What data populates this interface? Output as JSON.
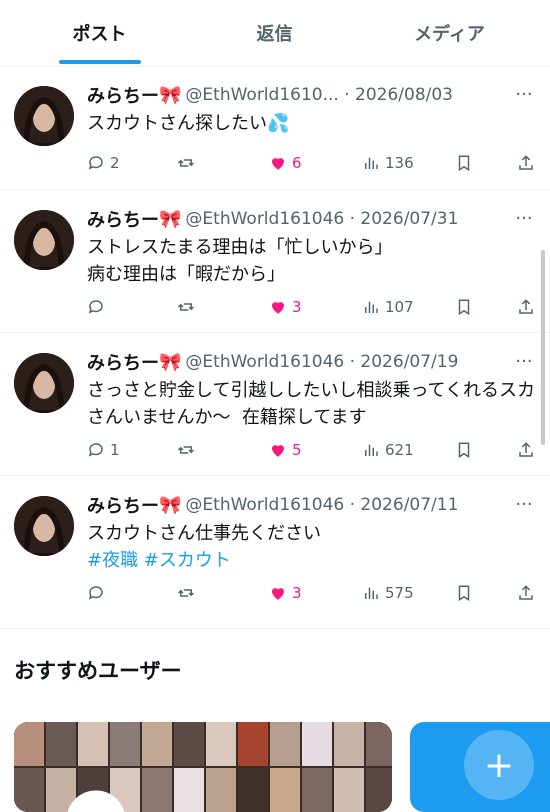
{
  "tabs": [
    {
      "label": "ポスト",
      "active": true
    },
    {
      "label": "返信",
      "active": false
    },
    {
      "label": "メディア",
      "active": false
    }
  ],
  "posts": [
    {
      "name": "みらちー",
      "ribbon": "🎀",
      "handle_date": "@EthWorld1610... · 2026/08/03",
      "text": "スカウトさん探したい💦",
      "replies": "2",
      "reposts": "",
      "likes": "6",
      "views": "136"
    },
    {
      "name": "みらちー",
      "ribbon": "🎀",
      "handle_date": "@EthWorld161046 · 2026/07/31",
      "text": "ストレスたまる理由は「忙しいから」\n病む理由は「暇だから」",
      "replies": "",
      "reposts": "",
      "likes": "3",
      "views": "107"
    },
    {
      "name": "みらちー",
      "ribbon": "🎀",
      "handle_date": "@EthWorld161046 · 2026/07/19",
      "text": "さっさと貯金して引越ししたいし相談乗ってくれるスカさんいませんか〜  在籍探してます",
      "replies": "1",
      "reposts": "",
      "likes": "5",
      "views": "621"
    },
    {
      "name": "みらちー",
      "ribbon": "🎀",
      "handle_date": "@EthWorld161046 · 2026/07/11",
      "text": "スカウトさん仕事先ください",
      "hashtags": "#夜職 #スカウト",
      "replies": "",
      "reposts": "",
      "likes": "3",
      "views": "575"
    }
  ],
  "recommended": {
    "title": "おすすめユーザー",
    "follow_symbol": "+"
  },
  "colors": {
    "accent": "#1d9bf0",
    "like": "#f91880",
    "muted": "#536471"
  }
}
